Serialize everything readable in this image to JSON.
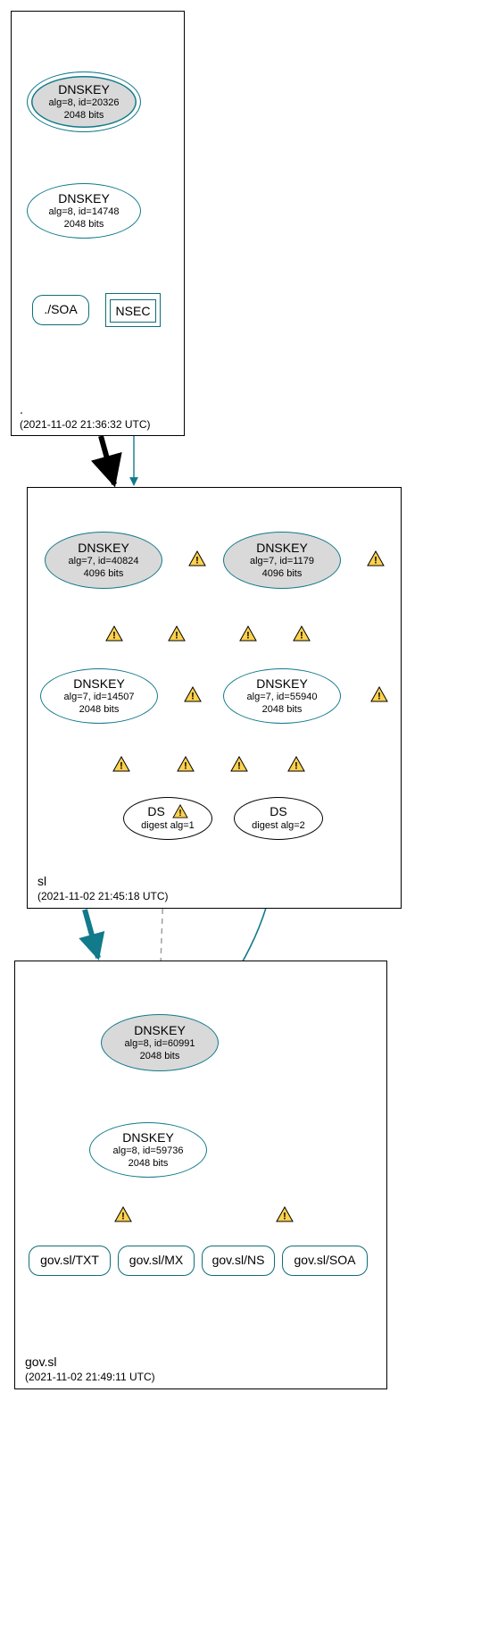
{
  "colors": {
    "teal": "#117a8b",
    "black": "#000000",
    "grey_fill": "#d9d9d9",
    "warn_fill": "#ffd24d",
    "warn_stroke": "#000000",
    "dashed_grey": "#999999"
  },
  "zones": [
    {
      "id": "root",
      "name_label": ".",
      "timestamp": "(2021-11-02 21:36:32 UTC)"
    },
    {
      "id": "sl",
      "name_label": "sl",
      "timestamp": "(2021-11-02 21:45:18 UTC)"
    },
    {
      "id": "govsl",
      "name_label": "gov.sl",
      "timestamp": "(2021-11-02 21:49:11 UTC)"
    }
  ],
  "nodes": {
    "root_ksk": {
      "title": "DNSKEY",
      "line2": "alg=8, id=20326",
      "line3": "2048 bits"
    },
    "root_zsk": {
      "title": "DNSKEY",
      "line2": "alg=8, id=14748",
      "line3": "2048 bits"
    },
    "root_soa": {
      "title": "./SOA"
    },
    "root_nsec": {
      "title": "NSEC"
    },
    "sl_ksk1": {
      "title": "DNSKEY",
      "line2": "alg=7, id=40824",
      "line3": "4096 bits"
    },
    "sl_ksk2": {
      "title": "DNSKEY",
      "line2": "alg=7, id=1179",
      "line3": "4096 bits"
    },
    "sl_zsk1": {
      "title": "DNSKEY",
      "line2": "alg=7, id=14507",
      "line3": "2048 bits"
    },
    "sl_zsk2": {
      "title": "DNSKEY",
      "line2": "alg=7, id=55940",
      "line3": "2048 bits"
    },
    "sl_ds1": {
      "title": "DS",
      "line2": "digest alg=1"
    },
    "sl_ds2": {
      "title": "DS",
      "line2": "digest alg=2"
    },
    "gov_ksk": {
      "title": "DNSKEY",
      "line2": "alg=8, id=60991",
      "line3": "2048 bits"
    },
    "gov_zsk": {
      "title": "DNSKEY",
      "line2": "alg=8, id=59736",
      "line3": "2048 bits"
    },
    "gov_txt": {
      "title": "gov.sl/TXT"
    },
    "gov_mx": {
      "title": "gov.sl/MX"
    },
    "gov_ns": {
      "title": "gov.sl/NS"
    },
    "gov_soa": {
      "title": "gov.sl/SOA"
    }
  },
  "edges_description": [
    "root_ksk self-loop (teal)",
    "root_ksk -> root_zsk (teal)",
    "root_zsk -> root_soa (teal)",
    "root_zsk -> root_nsec (teal)",
    "root_nsec -> sl zone top (teal thin)",
    "root zone -> sl zone (thick black)",
    "sl_ksk1 self-loop (teal) +warn",
    "sl_ksk2 self-loop (teal) +warn",
    "sl_ksk1 -> sl_zsk1 (teal) +warn",
    "sl_ksk1 -> sl_zsk2 (teal) +warn",
    "sl_ksk2 -> sl_zsk1 (teal) +warn",
    "sl_ksk2 -> sl_zsk2 (teal) +warn",
    "sl_zsk1 self-loop (teal) +warn",
    "sl_zsk2 self-loop (teal) +warn",
    "sl_zsk1 -> sl_ds1 (teal) +warn",
    "sl_zsk1 -> sl_ds2 (teal) +warn",
    "sl_zsk2 -> sl_ds1 (teal) +warn",
    "sl_zsk2 -> sl_ds2 (teal) +warn",
    "sl zone -> gov.sl zone (thick teal)",
    "sl_ds1 -> gov_ksk (grey dashed)",
    "sl_ds2 -> gov_ksk (teal)",
    "gov_ksk self-loop (teal)",
    "gov_ksk -> gov_zsk (teal)",
    "gov_zsk self-loop (teal)",
    "gov_zsk -> gov_txt (teal) +warn",
    "gov_zsk -> gov_mx (teal)",
    "gov_zsk -> gov_ns (teal)",
    "gov_zsk -> gov_soa (teal) +warn"
  ]
}
